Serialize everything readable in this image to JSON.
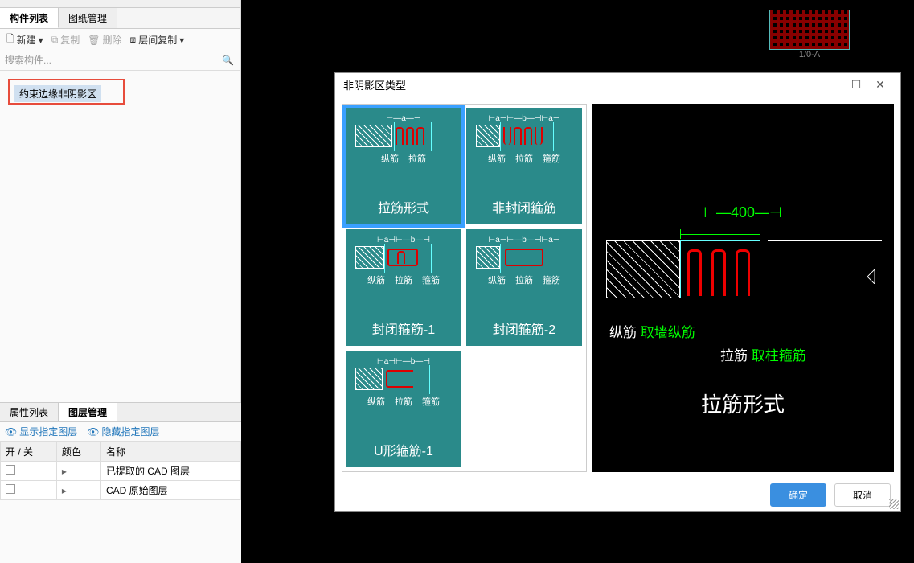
{
  "left": {
    "tabs": {
      "components": "构件列表",
      "drawings": "图纸管理"
    },
    "toolbar": {
      "new": "新建",
      "copy": "复制",
      "delete": "删除",
      "floor_copy": "层间复制"
    },
    "search_placeholder": "搜索构件...",
    "tree_item": "约束边缘非阴影区"
  },
  "bottom": {
    "tabs": {
      "props": "属性列表",
      "layers": "图层管理"
    },
    "toolbar": {
      "show": "显示指定图层",
      "hide": "隐藏指定图层"
    },
    "headers": {
      "onoff": "开 / 关",
      "color": "颜色",
      "name": "名称"
    },
    "rows": [
      {
        "name": "已提取的 CAD 图层"
      },
      {
        "name": "CAD 原始图层"
      }
    ]
  },
  "dialog": {
    "title": "非阴影区类型",
    "options": [
      {
        "title": "拉筋形式",
        "labels": [
          "纵筋",
          "拉筋"
        ],
        "dim": "⊢—a—⊣"
      },
      {
        "title": "非封闭箍筋",
        "labels": [
          "纵筋",
          "拉筋",
          "箍筋"
        ],
        "dim": "⊢a⊣⊢—b—⊣⊢a⊣"
      },
      {
        "title": "封闭箍筋-1",
        "labels": [
          "纵筋",
          "拉筋",
          "箍筋"
        ],
        "dim": "⊢a⊣⊢—b—⊣"
      },
      {
        "title": "封闭箍筋-2",
        "labels": [
          "纵筋",
          "拉筋",
          "箍筋"
        ],
        "dim": "⊢a⊣⊢—b—⊣⊢a⊣"
      },
      {
        "title": "U形箍筋-1",
        "labels": [
          "纵筋",
          "拉筋",
          "箍筋"
        ],
        "dim": "⊢a⊣⊢—b—⊣"
      }
    ],
    "preview": {
      "dimension": "400",
      "row1_a": "纵筋",
      "row1_b": "取墙纵筋",
      "row2_a": "拉筋",
      "row2_b": "取柱箍筋",
      "title": "拉筋形式"
    },
    "buttons": {
      "ok": "确定",
      "cancel": "取消"
    }
  },
  "bg_label": "1/0-A"
}
